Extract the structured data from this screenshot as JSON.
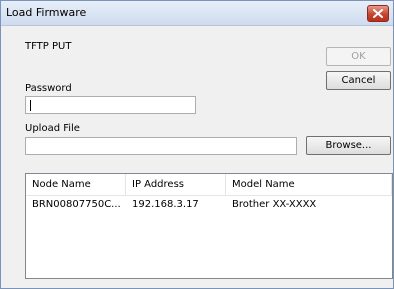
{
  "window": {
    "title": "Load Firmware",
    "close_icon": "close-icon"
  },
  "protocol_label": "TFTP PUT",
  "buttons": {
    "ok": "OK",
    "cancel": "Cancel",
    "browse": "Browse..."
  },
  "password": {
    "label": "Password",
    "value": ""
  },
  "upload_file": {
    "label": "Upload File",
    "value": ""
  },
  "device_list": {
    "columns": [
      "Node Name",
      "IP Address",
      "Model Name"
    ],
    "rows": [
      [
        "BRN00807750C...",
        "192.168.3.17",
        "Brother XX-XXXX"
      ]
    ]
  },
  "colors": {
    "title_bar": "#cfdcef",
    "close_button": "#c54631"
  }
}
